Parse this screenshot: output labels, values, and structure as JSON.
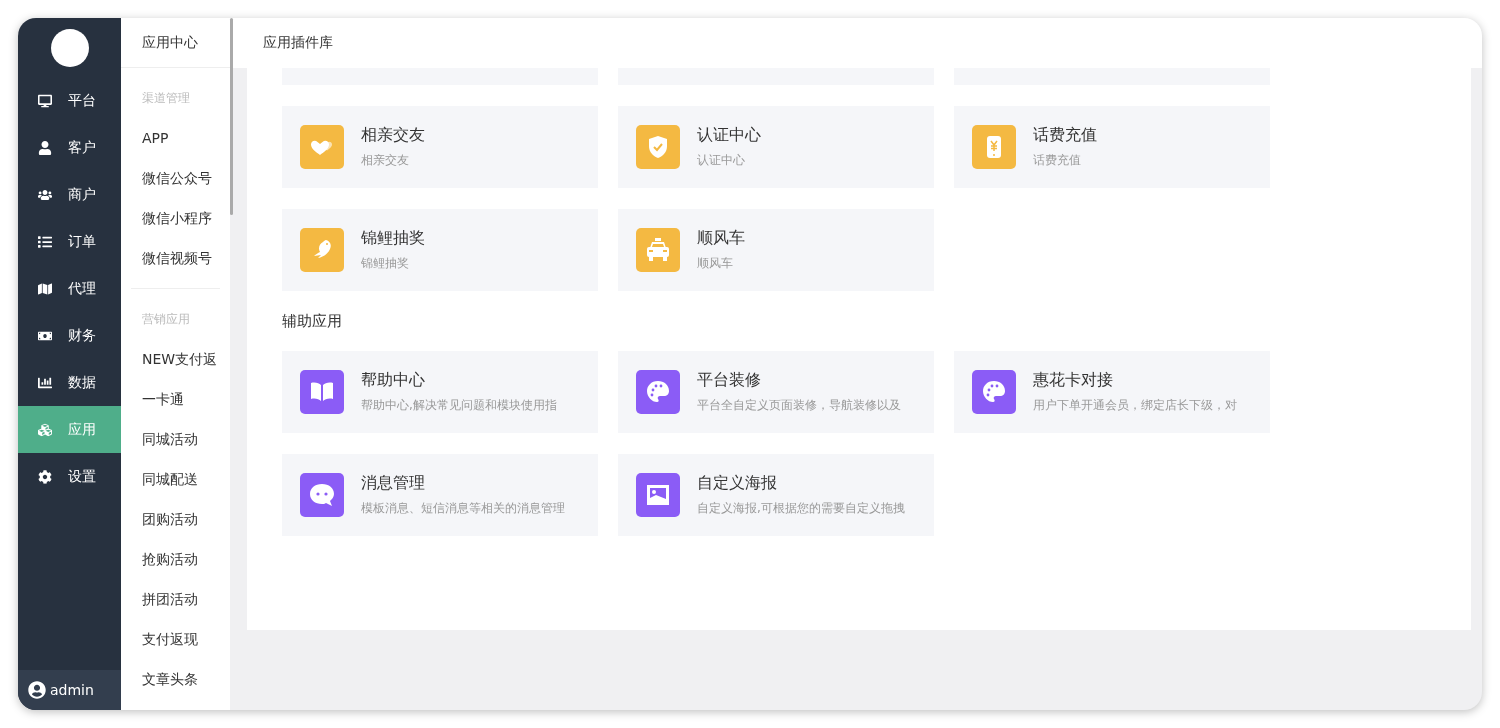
{
  "nav": {
    "items": [
      {
        "label": "平台",
        "kind": "desktop",
        "selected": false
      },
      {
        "label": "客户",
        "kind": "user",
        "selected": false
      },
      {
        "label": "商户",
        "kind": "users",
        "selected": false
      },
      {
        "label": "订单",
        "kind": "list",
        "selected": false
      },
      {
        "label": "代理",
        "kind": "map",
        "selected": false
      },
      {
        "label": "财务",
        "kind": "money",
        "selected": false
      },
      {
        "label": "数据",
        "kind": "chart",
        "selected": false
      },
      {
        "label": "应用",
        "kind": "cubes",
        "selected": true
      },
      {
        "label": "设置",
        "kind": "gear",
        "selected": false
      }
    ],
    "user": "admin"
  },
  "submenu": {
    "title": "应用中心",
    "groups": [
      {
        "heading": "渠道管理",
        "items": [
          "APP",
          "微信公众号",
          "微信小程序",
          "微信视频号"
        ]
      },
      {
        "heading": "营销应用",
        "items": [
          "NEW支付返",
          "一卡通",
          "同城活动",
          "同城配送",
          "团购活动",
          "抢购活动",
          "拼团活动",
          "支付返现",
          "文章头条"
        ]
      }
    ]
  },
  "header": {
    "tab": "应用插件库"
  },
  "sections": [
    {
      "color": "#f4b942",
      "partial_cards": [
        {
          "kind": "blank"
        },
        {
          "kind": "blank"
        },
        {
          "kind": "blank"
        }
      ],
      "cards": [
        {
          "kind": "hearts",
          "title": "相亲交友",
          "desc": "相亲交友"
        },
        {
          "kind": "shield",
          "title": "认证中心",
          "desc": "认证中心"
        },
        {
          "kind": "phone",
          "title": "话费充值",
          "desc": "话费充值"
        },
        {
          "kind": "dolphin",
          "title": "锦鲤抽奖",
          "desc": "锦鲤抽奖"
        },
        {
          "kind": "taxi",
          "title": "顺风车",
          "desc": "顺风车"
        }
      ]
    },
    {
      "title": "辅助应用",
      "color": "#8b5cf6",
      "cards": [
        {
          "kind": "book",
          "title": "帮助中心",
          "desc": "帮助中心,解决常见问题和模块使用指"
        },
        {
          "kind": "palette",
          "title": "平台装修",
          "desc": "平台全自定义页面装修，导航装修以及"
        },
        {
          "kind": "palette",
          "title": "惠花卡对接",
          "desc": "用户下单开通会员，绑定店长下级，对"
        },
        {
          "kind": "chat",
          "title": "消息管理",
          "desc": "模板消息、短信消息等相关的消息管理"
        },
        {
          "kind": "image",
          "title": "自定义海报",
          "desc": "自定义海报,可根据您的需要自定义拖拽"
        }
      ]
    }
  ]
}
